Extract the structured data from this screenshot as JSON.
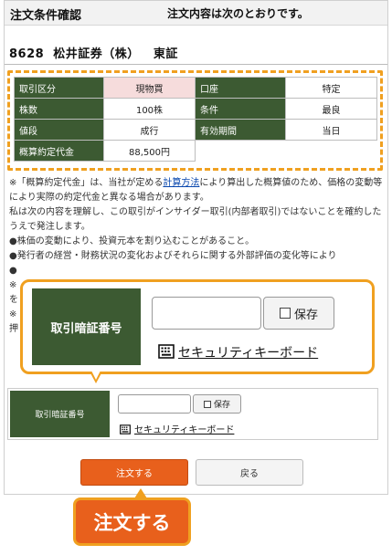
{
  "header": {
    "title": "注文条件確認",
    "message": "注文内容は次のとおりです。"
  },
  "stock": {
    "code": "8628",
    "name": "松井証券（株）",
    "market": "東証"
  },
  "order_table": {
    "rows": [
      {
        "label1": "取引区分",
        "value1": "現物買",
        "label2": "口座",
        "value2": "特定"
      },
      {
        "label1": "株数",
        "value1": "100株",
        "label2": "条件",
        "value2": "最良"
      },
      {
        "label1": "値段",
        "value1": "成行",
        "label2": "有効期間",
        "value2": "当日"
      },
      {
        "label1": "概算約定代金",
        "value1": "88,500円"
      }
    ]
  },
  "notes": {
    "line1_pre": "※「概算約定代金」は、当社が定める",
    "line1_link": "計算方法",
    "line1_post": "により算出した概算値のため、価格の変動等により実際の約定代金と異なる場合があります。",
    "line2": "私は次の内容を理解し、この取引がインサイダー取引(内部者取引)ではないことを確約したうえで発注します。",
    "line3": "●株価の変動により、投資元本を割り込むことがあること。",
    "line4": "●発行者の経営・財務状況の変化およびそれらに関する外部評価の変化等により",
    "frag1": "●",
    "frag2": "※",
    "frag3": "を",
    "frag4": "※",
    "frag5": "押"
  },
  "pin": {
    "label": "取引暗証番号",
    "input_value": "",
    "save_label": "保存",
    "keyboard_label": "セキュリティキーボード"
  },
  "buttons": {
    "order": "注文する",
    "back": "戻る"
  },
  "callout": {
    "label": "注文する"
  },
  "colors": {
    "accent": "#f0a020",
    "label_bg": "#3c5a32",
    "order_button": "#e8601c",
    "pink_cell": "#f6dcdc",
    "link": "#0645ad"
  }
}
